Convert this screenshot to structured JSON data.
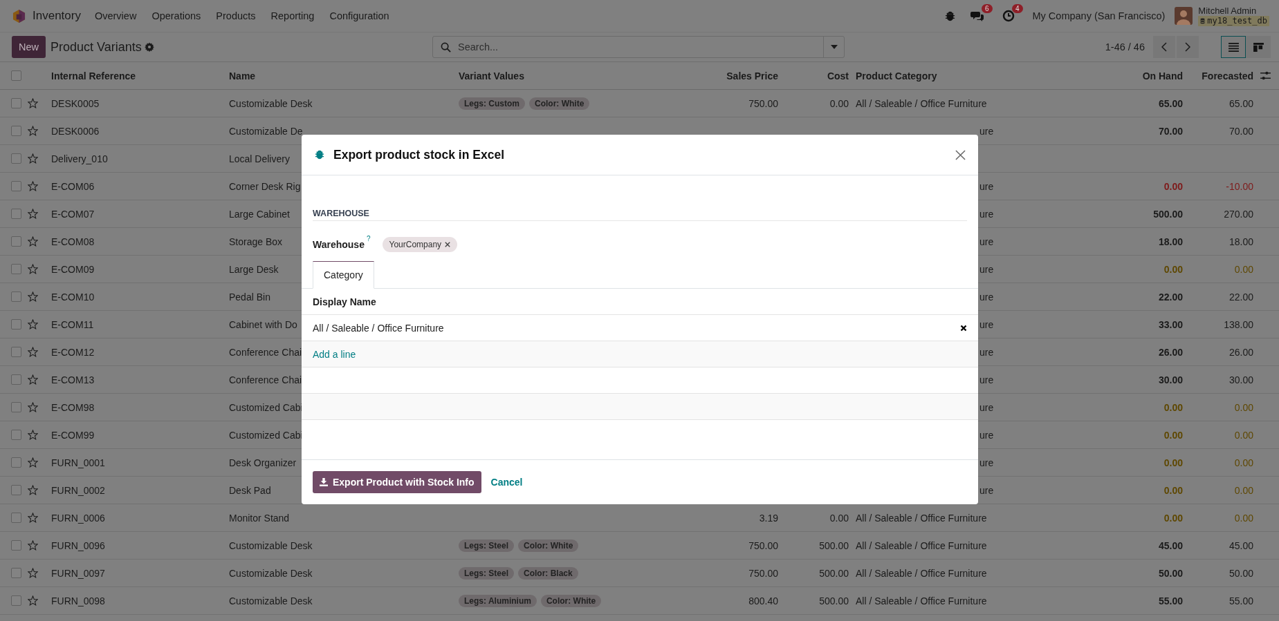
{
  "navbar": {
    "app_name": "Inventory",
    "menu": [
      "Overview",
      "Operations",
      "Products",
      "Reporting",
      "Configuration"
    ],
    "chat_count": "6",
    "activity_count": "4",
    "company": "My Company (San Francisco)",
    "user_name": "Mitchell Admin",
    "database": "my18_test_db"
  },
  "control_panel": {
    "new_button": "New",
    "title": "Product Variants",
    "search": {
      "placeholder": "Search..."
    },
    "pager": "1-46 / 46",
    "views": [
      {
        "kind": "list",
        "selected": true
      },
      {
        "kind": "kanban",
        "selected": false
      }
    ]
  },
  "table": {
    "all_checked": false,
    "columns": [
      "Internal Reference",
      "Name",
      "Variant Values",
      "Sales Price",
      "Cost",
      "Product Category",
      "On Hand",
      "Forecasted"
    ],
    "rows": [
      {
        "reference": "DESK0005",
        "name": "Customizable Desk",
        "variant_values": [
          "Legs: Custom",
          "Color: White"
        ],
        "sales_price": "750.00",
        "cost": "0.00",
        "category": "All / Saleable / Office Furniture",
        "on_hand": "65.00",
        "forecasted": "65.00",
        "color": "#1a1a1a",
        "checked": false,
        "favorite": false,
        "covered": false
      },
      {
        "reference": "DESK0006",
        "name": "Customizable De",
        "category": "ure",
        "on_hand": "70.00",
        "forecasted": "70.00",
        "color": "#1a1a1a",
        "checked": false,
        "favorite": false,
        "covered": true
      },
      {
        "reference": "Delivery_010",
        "name": "Local Delivery",
        "checked": false,
        "favorite": false
      },
      {
        "reference": "E-COM06",
        "name": "Corner Desk Rig",
        "category": "ure",
        "on_hand": "0.00",
        "forecasted": "-10.00",
        "color": "#7e1a1a",
        "checked": false,
        "favorite": false,
        "covered": true
      },
      {
        "reference": "E-COM07",
        "name": "Large Cabinet",
        "category": "ure",
        "on_hand": "500.00",
        "forecasted": "270.00",
        "color": "#1a1a1a",
        "checked": false,
        "favorite": false,
        "covered": true
      },
      {
        "reference": "E-COM08",
        "name": "Storage Box",
        "category": "ure",
        "on_hand": "18.00",
        "forecasted": "18.00",
        "color": "#1a1a1a",
        "checked": false,
        "favorite": false,
        "covered": true
      },
      {
        "reference": "E-COM09",
        "name": "Large Desk",
        "category": "ure",
        "on_hand": "0.00",
        "forecasted": "0.00",
        "color": "#5e4700",
        "checked": false,
        "favorite": false,
        "covered": true
      },
      {
        "reference": "E-COM10",
        "name": "Pedal Bin",
        "category": "ure",
        "on_hand": "22.00",
        "forecasted": "22.00",
        "color": "#1a1a1a",
        "checked": false,
        "favorite": false,
        "covered": true
      },
      {
        "reference": "E-COM11",
        "name": "Cabinet with Do",
        "category": "ure",
        "on_hand": "33.00",
        "forecasted": "138.00",
        "color": "#1a1a1a",
        "checked": false,
        "favorite": false,
        "covered": true
      },
      {
        "reference": "E-COM12",
        "name": "Conference Chai",
        "category": "ure",
        "on_hand": "26.00",
        "forecasted": "26.00",
        "color": "#1a1a1a",
        "checked": false,
        "favorite": false,
        "covered": true
      },
      {
        "reference": "E-COM13",
        "name": "Conference Chai",
        "category": "ure",
        "on_hand": "30.00",
        "forecasted": "30.00",
        "color": "#1a1a1a",
        "checked": false,
        "favorite": false,
        "covered": true
      },
      {
        "reference": "E-COM98",
        "name": "Customized Cabi",
        "category": "ure",
        "on_hand": "0.00",
        "forecasted": "0.00",
        "color": "#5e4700",
        "checked": false,
        "favorite": false,
        "covered": true
      },
      {
        "reference": "E-COM99",
        "name": "Customized Cabi",
        "category": "ure",
        "on_hand": "0.00",
        "forecasted": "0.00",
        "color": "#5e4700",
        "checked": false,
        "favorite": false,
        "covered": true
      },
      {
        "reference": "FURN_0001",
        "name": "Desk Organizer",
        "category": "ure",
        "on_hand": "0.00",
        "forecasted": "0.00",
        "color": "#5e4700",
        "checked": false,
        "favorite": false,
        "covered": true
      },
      {
        "reference": "FURN_0002",
        "name": "Desk Pad",
        "category": "ure",
        "on_hand": "0.00",
        "forecasted": "0.00",
        "color": "#5e4700",
        "checked": false,
        "favorite": false,
        "covered": true
      },
      {
        "reference": "FURN_0006",
        "name": "Monitor Stand",
        "sales_price": "3.19",
        "cost": "0.00",
        "category": "All / Saleable / Office Furniture",
        "on_hand": "0.00",
        "forecasted": "0.00",
        "color": "#5e4700",
        "checked": false,
        "favorite": false,
        "covered": false
      },
      {
        "reference": "FURN_0096",
        "name": "Customizable Desk",
        "variant_values": [
          "Legs: Steel",
          "Color: White"
        ],
        "sales_price": "750.00",
        "cost": "500.00",
        "category": "All / Saleable / Office Furniture",
        "on_hand": "45.00",
        "forecasted": "45.00",
        "color": "#1a1a1a",
        "checked": false,
        "favorite": false,
        "covered": false
      },
      {
        "reference": "FURN_0097",
        "name": "Customizable Desk",
        "variant_values": [
          "Legs: Steel",
          "Color: Black"
        ],
        "sales_price": "750.00",
        "cost": "500.00",
        "category": "All / Saleable / Office Furniture",
        "on_hand": "50.00",
        "forecasted": "50.00",
        "color": "#1a1a1a",
        "checked": false,
        "favorite": false,
        "covered": false
      },
      {
        "reference": "FURN_0098",
        "name": "Customizable Desk",
        "variant_values": [
          "Legs: Aluminium",
          "Color: White"
        ],
        "sales_price": "800.40",
        "cost": "500.00",
        "category": "All / Saleable / Office Furniture",
        "on_hand": "55.00",
        "forecasted": "55.00",
        "color": "#1a1a1a",
        "checked": false,
        "favorite": false,
        "covered": false
      }
    ]
  },
  "dialog": {
    "title": "Export product stock in Excel",
    "section": "WAREHOUSE",
    "warehouse_label": "Warehouse",
    "help_mark": "?",
    "warehouse_tags": [
      "YourCompany"
    ],
    "tabs": [
      {
        "label": "Category",
        "selected": true
      }
    ],
    "lines_header": "Display Name",
    "lines": [
      "All / Saleable / Office Furniture"
    ],
    "add_line": "Add a line",
    "export_button": "Export Product with Stock Info",
    "cancel": "Cancel"
  }
}
